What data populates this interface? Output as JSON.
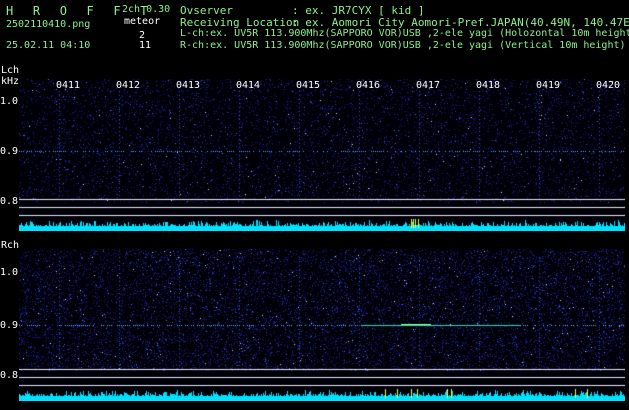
{
  "header": {
    "title": "H R O F F T",
    "version": "2ch 0.30",
    "filename": "2502110410.png",
    "mode": "meteor",
    "timestamp": "25.02.11 04:10",
    "count_l": "2",
    "count_r": "11"
  },
  "info": {
    "observer_label": "Ovserver",
    "observer_value": ": ex. JR7CYX [ kid ]",
    "location_label": "Receiving Location",
    "location_value": ": ex. Aomori City Aomori-Pref.JAPAN(40.49N, 140.47E)",
    "lch_line": "L-ch:ex. UV5R 113.900Mhz(SAPPORO VOR)USB ,2-ele yagi (Holozontal 10m height",
    "rch_line": "R-ch:ex. UV5R 113.900Mhz(SAPPORO VOR)USB ,2-ele yagi (Vertical 10m height)"
  },
  "left_channel": {
    "label": "Lch",
    "unit": "kHz",
    "y_ticks": [
      "1.0",
      "0.9",
      "0.8"
    ]
  },
  "right_channel": {
    "label": "Rch",
    "y_ticks": [
      "1.0",
      "0.9",
      "0.8"
    ]
  },
  "time_ticks": [
    "0411",
    "0412",
    "0413",
    "0414",
    "0415",
    "0416",
    "0417",
    "0418",
    "0419",
    "0420"
  ],
  "colors": {
    "background": "#000000",
    "noise": "#2030a0",
    "trace": "#00e0ff",
    "text_green": "#8ef08e",
    "text_white": "#ffffff"
  }
}
